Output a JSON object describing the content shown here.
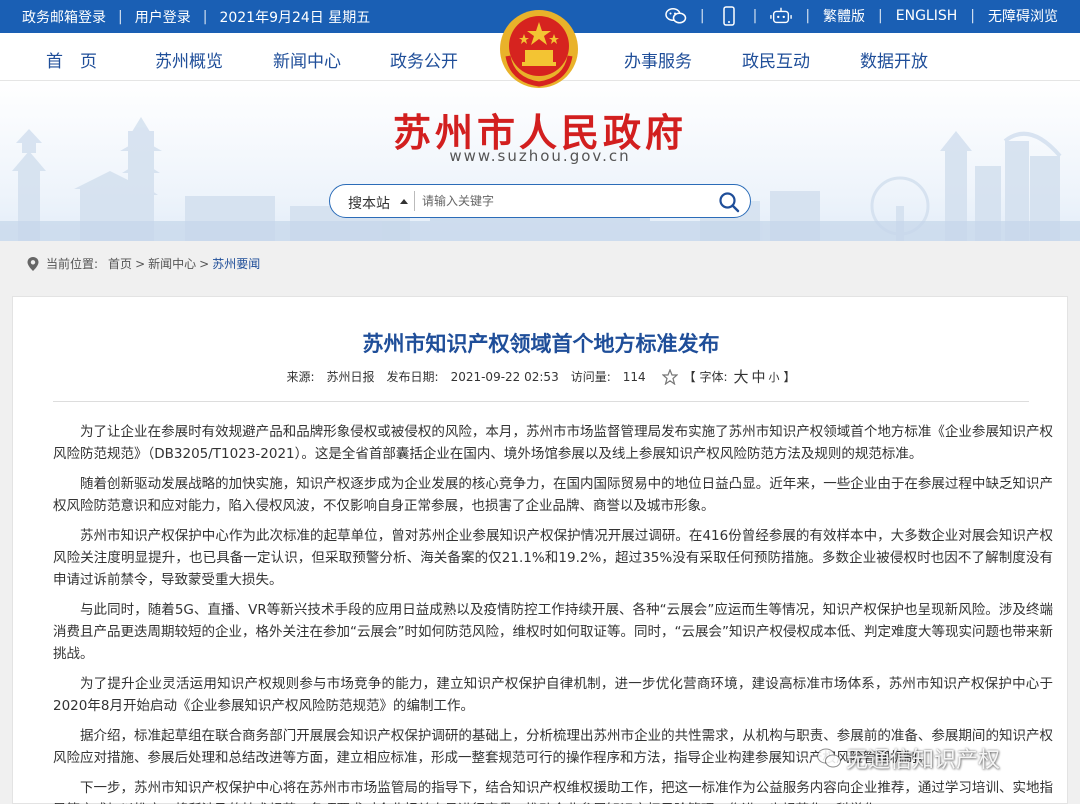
{
  "topbar": {
    "links_left": [
      "政务邮箱登录",
      "用户登录",
      "2021年9月24日 星期五"
    ],
    "links_right": [
      "繁體版",
      "ENGLISH",
      "无障碍浏览"
    ],
    "icons": [
      "wechat-icon",
      "mobile-icon",
      "robot-icon"
    ]
  },
  "nav": {
    "items": [
      "首　页",
      "苏州概览",
      "新闻中心",
      "政务公开",
      "办事服务",
      "政民互动",
      "数据开放"
    ],
    "active": "新闻中心"
  },
  "header": {
    "site_title": "苏州市人民政府",
    "site_url": "www.suzhou.gov.cn",
    "search_scope": "搜本站",
    "search_placeholder": "请输入关键字"
  },
  "breadcrumb": {
    "label": "当前位置:",
    "items": [
      "首页",
      "新闻中心",
      "苏州要闻"
    ]
  },
  "article": {
    "title": "苏州市知识产权领域首个地方标准发布",
    "meta": {
      "source_label": "来源:",
      "source": "苏州日报",
      "date_label": "发布日期:",
      "date": "2021-09-22 02:53",
      "views_label": "访问量:",
      "views": "114",
      "font_label": "【 字体:",
      "font_large": "大",
      "font_medium": "中",
      "font_small": "小",
      "font_close": "】"
    },
    "paragraphs": [
      "为了让企业在参展时有效规避产品和品牌形象侵权或被侵权的风险，本月，苏州市市场监督管理局发布实施了苏州市知识产权领域首个地方标准《企业参展知识产权风险防范规范》（DB3205/T1023-2021）。这是全省首部囊括企业在国内、境外场馆参展以及线上参展知识产权风险防范方法及规则的规范标准。",
      "随着创新驱动发展战略的加快实施，知识产权逐步成为企业发展的核心竞争力，在国内国际贸易中的地位日益凸显。近年来，一些企业由于在参展过程中缺乏知识产权风险防范意识和应对能力，陷入侵权风波，不仅影响自身正常参展，也损害了企业品牌、商誉以及城市形象。",
      "苏州市知识产权保护中心作为此次标准的起草单位，曾对苏州企业参展知识产权保护情况开展过调研。在416份曾经参展的有效样本中，大多数企业对展会知识产权风险关注度明显提升，也已具备一定认识，但采取预警分析、海关备案的仅21.1%和19.2%，超过35%没有采取任何预防措施。多数企业被侵权时也因不了解制度没有申请过诉前禁令，导致蒙受重大损失。",
      "与此同时，随着5G、直播、VR等新兴技术手段的应用日益成熟以及疫情防控工作持续开展、各种“云展会”应运而生等情况，知识产权保护也呈现新风险。涉及终端消费且产品更迭周期较短的企业，格外关注在参加“云展会”时如何防范风险，维权时如何取证等。同时，“云展会”知识产权侵权成本低、判定难度大等现实问题也带来新挑战。",
      "为了提升企业灵活运用知识产权规则参与市场竞争的能力，建立知识产权保护自律机制，进一步优化营商环境，建设高标准市场体系，苏州市知识产权保护中心于2020年8月开始启动《企业参展知识产权风险防范规范》的编制工作。",
      "据介绍，标准起草组在联合商务部门开展展会知识产权保护调研的基础上，分析梳理出苏州市企业的共性需求，从机构与职责、参展前的准备、参展期间的知识产权风险应对措施、参展后处理和总结改进等方面，建立相应标准，形成一整套规范可行的操作程序和方法，指导企业构建参展知识产权风险管理机制。",
      "下一步，苏州市知识产权保护中心将在苏州市市场监管局的指导下，结合知识产权维权援助工作，把这一标准作为公益服务内容向企业推荐，通过学习培训、实地指导等方式加以推广，将所涉及的技术规范、各项要求对企业相关人员进行宣贯，推动企业参展知识产权风险管理工作进一步规范化、科学化。"
    ]
  },
  "watermark": {
    "text": "无通信知识产权"
  },
  "colors": {
    "topbar_bg": "#1a5fb4",
    "nav_text": "#1f4e99",
    "site_title": "#d21f1f",
    "article_title": "#1f4e99"
  }
}
